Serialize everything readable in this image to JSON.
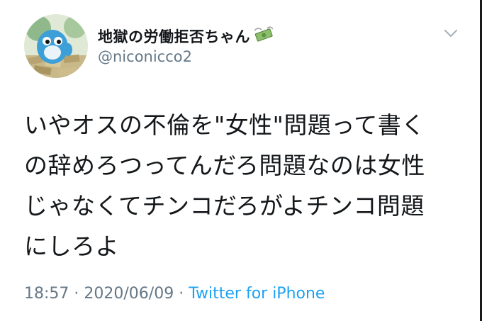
{
  "user": {
    "display_name": "地獄の労働拒否ちゃん",
    "name_emoji": "money-with-wings-emoji",
    "handle": "@niconicco2"
  },
  "tweet": {
    "lines": [
      "いやオスの不倫を\"女性\"問題って書く",
      "の辞めろつってんだろ問題なのは女性",
      "じゃなくてチンコだろがよチンコ問題",
      "にしろよ"
    ],
    "time": "18:57",
    "date": "2020/06/09",
    "source": "Twitter for iPhone"
  },
  "colors": {
    "text": "#14171a",
    "secondary": "#657786",
    "link": "#1da1f2"
  },
  "icons": {
    "menu": "chevron-down-icon"
  }
}
